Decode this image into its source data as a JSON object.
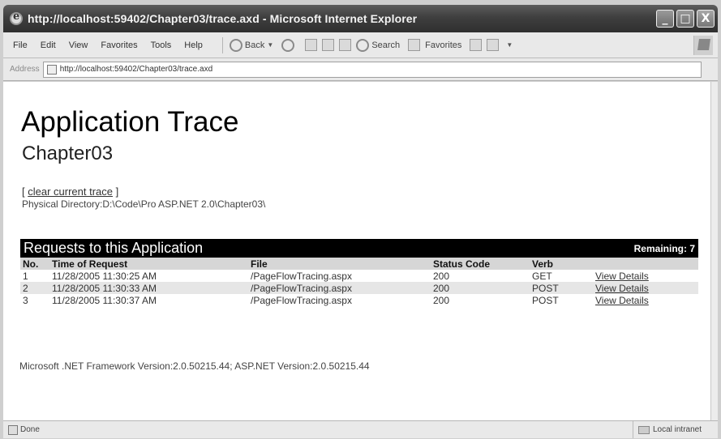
{
  "window": {
    "title": "http://localhost:59402/Chapter03/trace.axd - Microsoft Internet Explorer",
    "controls": [
      "_",
      "□",
      "X"
    ]
  },
  "menu": [
    "File",
    "Edit",
    "View",
    "Favorites",
    "Tools",
    "Help"
  ],
  "toolbar": {
    "back_label": "Back",
    "search_label": "Search",
    "favorites_label": "Favorites"
  },
  "address": {
    "label": "Address",
    "url": "http://localhost:59402/Chapter03/trace.axd"
  },
  "page": {
    "title": "Application Trace",
    "app_name": "Chapter03",
    "clear_prefix": "[",
    "clear_link": "clear current trace",
    "clear_suffix": "]",
    "physical_directory": "Physical Directory:D:\\Code\\Pro ASP.NET 2.0\\Chapter03\\"
  },
  "requests": {
    "title": "Requests to this Application",
    "remaining": "Remaining: 7",
    "columns": [
      "No.",
      "Time of Request",
      "File",
      "Status Code",
      "Verb",
      ""
    ],
    "rows": [
      {
        "no": "1",
        "time": "11/28/2005 11:30:25 AM",
        "file": "/PageFlowTracing.aspx",
        "status": "200",
        "verb": "GET",
        "link": "View Details"
      },
      {
        "no": "2",
        "time": "11/28/2005 11:30:33 AM",
        "file": "/PageFlowTracing.aspx",
        "status": "200",
        "verb": "POST",
        "link": "View Details"
      },
      {
        "no": "3",
        "time": "11/28/2005 11:30:37 AM",
        "file": "/PageFlowTracing.aspx",
        "status": "200",
        "verb": "POST",
        "link": "View Details"
      }
    ]
  },
  "footer": {
    "version": "Microsoft .NET Framework Version:2.0.50215.44; ASP.NET Version:2.0.50215.44"
  },
  "status": {
    "text": "Done",
    "zone": "Local intranet"
  }
}
